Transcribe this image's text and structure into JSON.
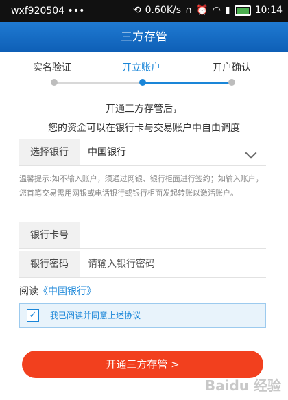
{
  "status_bar": {
    "carrier": "wxf920504 •••",
    "speed": "0.60K/s",
    "time": "10:14",
    "icons": [
      "headset-icon",
      "alarm-icon",
      "wifi-icon",
      "signal-icon",
      "battery-icon"
    ]
  },
  "header": {
    "title": "三方存管"
  },
  "steps": {
    "items": [
      "实名验证",
      "开立账户",
      "开户确认"
    ],
    "active_index": 1
  },
  "intro": {
    "line1": "开通三方存管后，",
    "line2": "您的资金可以在银行卡与交易账户中自由调度"
  },
  "form": {
    "bank_label": "选择银行",
    "bank_value": "中国银行",
    "card_label": "银行卡号",
    "card_value": "",
    "password_label": "银行密码",
    "password_placeholder": "请输入银行密码"
  },
  "tip": "温馨提示:如不输入账户，须通过网银、银行柜面进行签约；如输入账户，您首笔交易需用网银或电话银行或银行柜面发起转账以激活账户。",
  "read": {
    "prefix": "阅读",
    "link": "《中国银行》"
  },
  "agreement": {
    "checked": true,
    "text": "我已阅读并同意上述协议"
  },
  "submit": {
    "label": "开通三方存管 >"
  },
  "watermark": "Baidu 经验",
  "colors": {
    "accent": "#1a86d8",
    "button": "#f2401e",
    "header": "#1a76cf"
  }
}
